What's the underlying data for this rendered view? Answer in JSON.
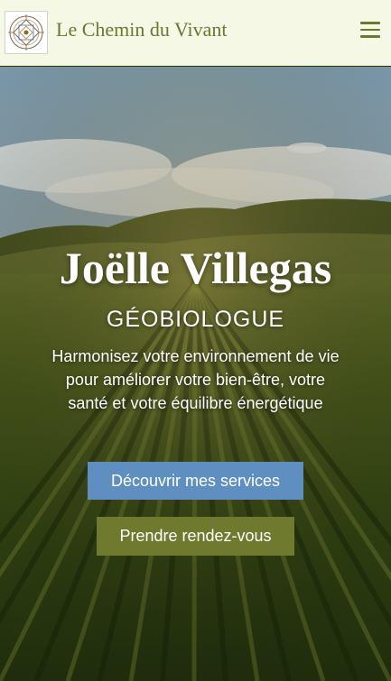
{
  "header": {
    "site_title": "Le Chemin du Vivant",
    "menu_icon": "hamburger-menu-icon",
    "logo_icon": "geometric-mandala-logo"
  },
  "hero": {
    "name": "Joëlle Villegas",
    "role": "GÉOBIOLOGUE",
    "tagline": "Harmonisez votre environnement de vie pour améliorer votre bien-être, votre santé et votre équilibre énergétique",
    "primary_button": "Découvrir mes services",
    "secondary_button": "Prendre rendez-vous",
    "background": "vineyard-landscape-image"
  },
  "colors": {
    "header_bg": "#f6f8e6",
    "brand_olive": "#6c7730",
    "button_blue": "#5e8fc0",
    "button_olive": "#6f7a2f"
  }
}
